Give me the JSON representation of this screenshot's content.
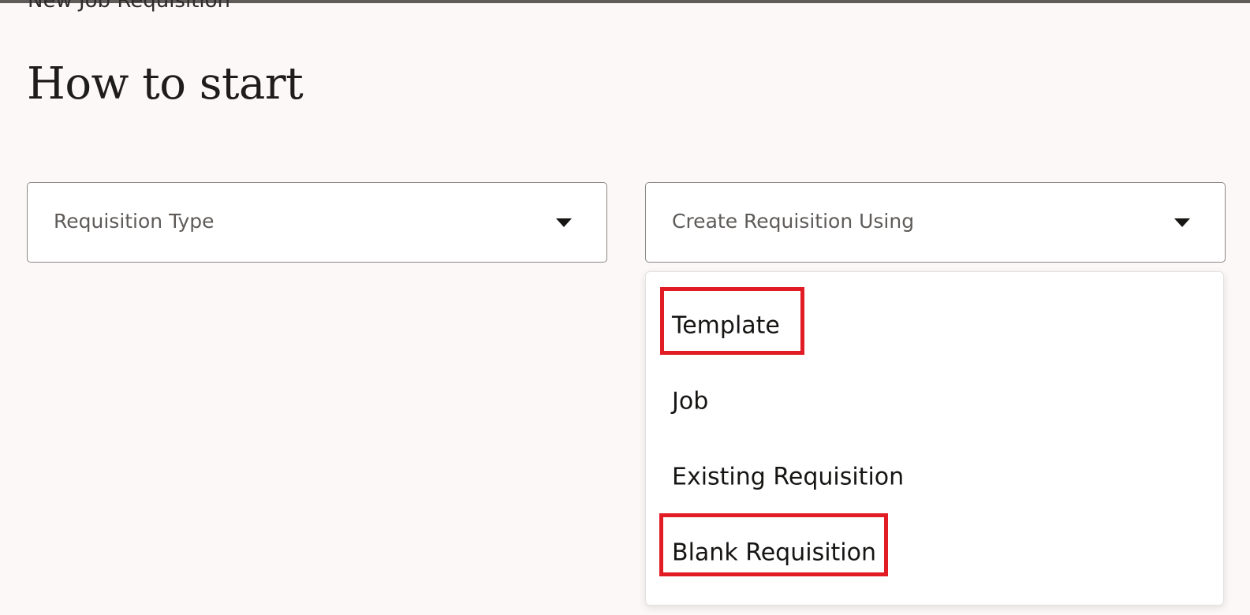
{
  "header": {
    "page_header": "New Job Requisition",
    "title": "How to start"
  },
  "fields": {
    "requisition_type": {
      "label": "Requisition Type",
      "icon": "chevron-down-icon"
    },
    "create_using": {
      "label": "Create Requisition Using",
      "icon": "chevron-down-icon",
      "expanded": true,
      "options": [
        {
          "label": "Template",
          "highlighted": true
        },
        {
          "label": "Job",
          "highlighted": false
        },
        {
          "label": "Existing Requisition",
          "highlighted": false
        },
        {
          "label": "Blank Requisition",
          "highlighted": true
        }
      ]
    }
  },
  "colors": {
    "background": "#fcf8f7",
    "highlight": "#e21c24",
    "text": "#161513",
    "placeholder": "#5e5b59",
    "border": "#8b8785"
  }
}
